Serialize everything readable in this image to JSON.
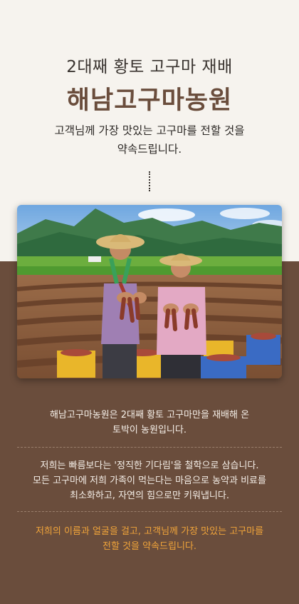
{
  "header": {
    "subtitle": "2대째 황토 고구마 재배",
    "brand": "해남고구마농원",
    "promise_line1": "고객님께 가장 맛있는 고구마를 전할 것을",
    "promise_line2": "약속드립니다."
  },
  "story": {
    "para1_line1": "해남고구마농원은 2대째 황토 고구마만을 재배해 온",
    "para1_line2": "토박이 농원입니다.",
    "para2_line1": "저희는 빠름보다는 '정직한 기다림'을 철학으로 삼습니다.",
    "para2_line2": "모든 고구마에 저희 가족이 먹는다는 마음으로 농약과 비료를",
    "para2_line3": "최소화하고, 자연의 힘으로만 키워냅니다.",
    "para3_line1": "저희의 이름과 얼굴을 걸고, 고객님께 가장 맛있는 고구마를",
    "para3_line2": "전할 것을 약속드립니다."
  },
  "colors": {
    "background_top": "#f6f3ee",
    "background_bottom": "#6a4d3c",
    "brand": "#6a4d3c",
    "accent": "#f0a43a"
  }
}
